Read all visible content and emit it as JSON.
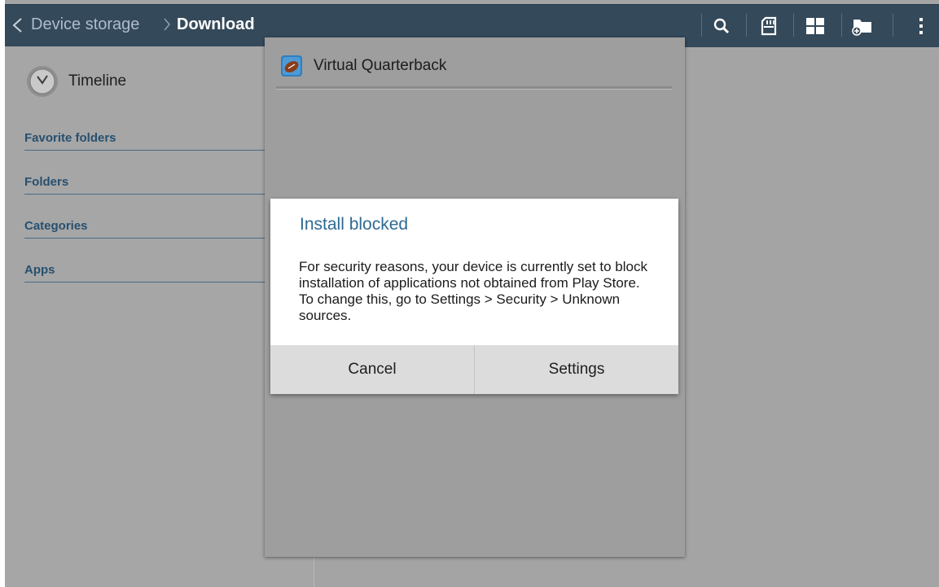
{
  "action_bar": {
    "breadcrumb": [
      "Device storage",
      "Download"
    ],
    "icons": [
      "search-icon",
      "sd-card-icon",
      "grid-view-icon",
      "new-folder-icon",
      "overflow-menu-icon"
    ]
  },
  "sidebar": {
    "timeline_label": "Timeline",
    "sections": [
      "Favorite folders",
      "Folders",
      "Categories",
      "Apps"
    ]
  },
  "installer": {
    "app_name": "Virtual Quarterback"
  },
  "dialog": {
    "title": "Install blocked",
    "message": "For security reasons, your device is currently set to block installation of applications not obtained from Play Store. To change this, go to Settings > Security > Unknown sources.",
    "buttons": {
      "cancel": "Cancel",
      "settings": "Settings"
    }
  },
  "colors": {
    "action_bar": "#34495a",
    "dialog_title": "#2e6a93",
    "section_text": "#27506f",
    "dim_background": "#a4a4a4"
  }
}
